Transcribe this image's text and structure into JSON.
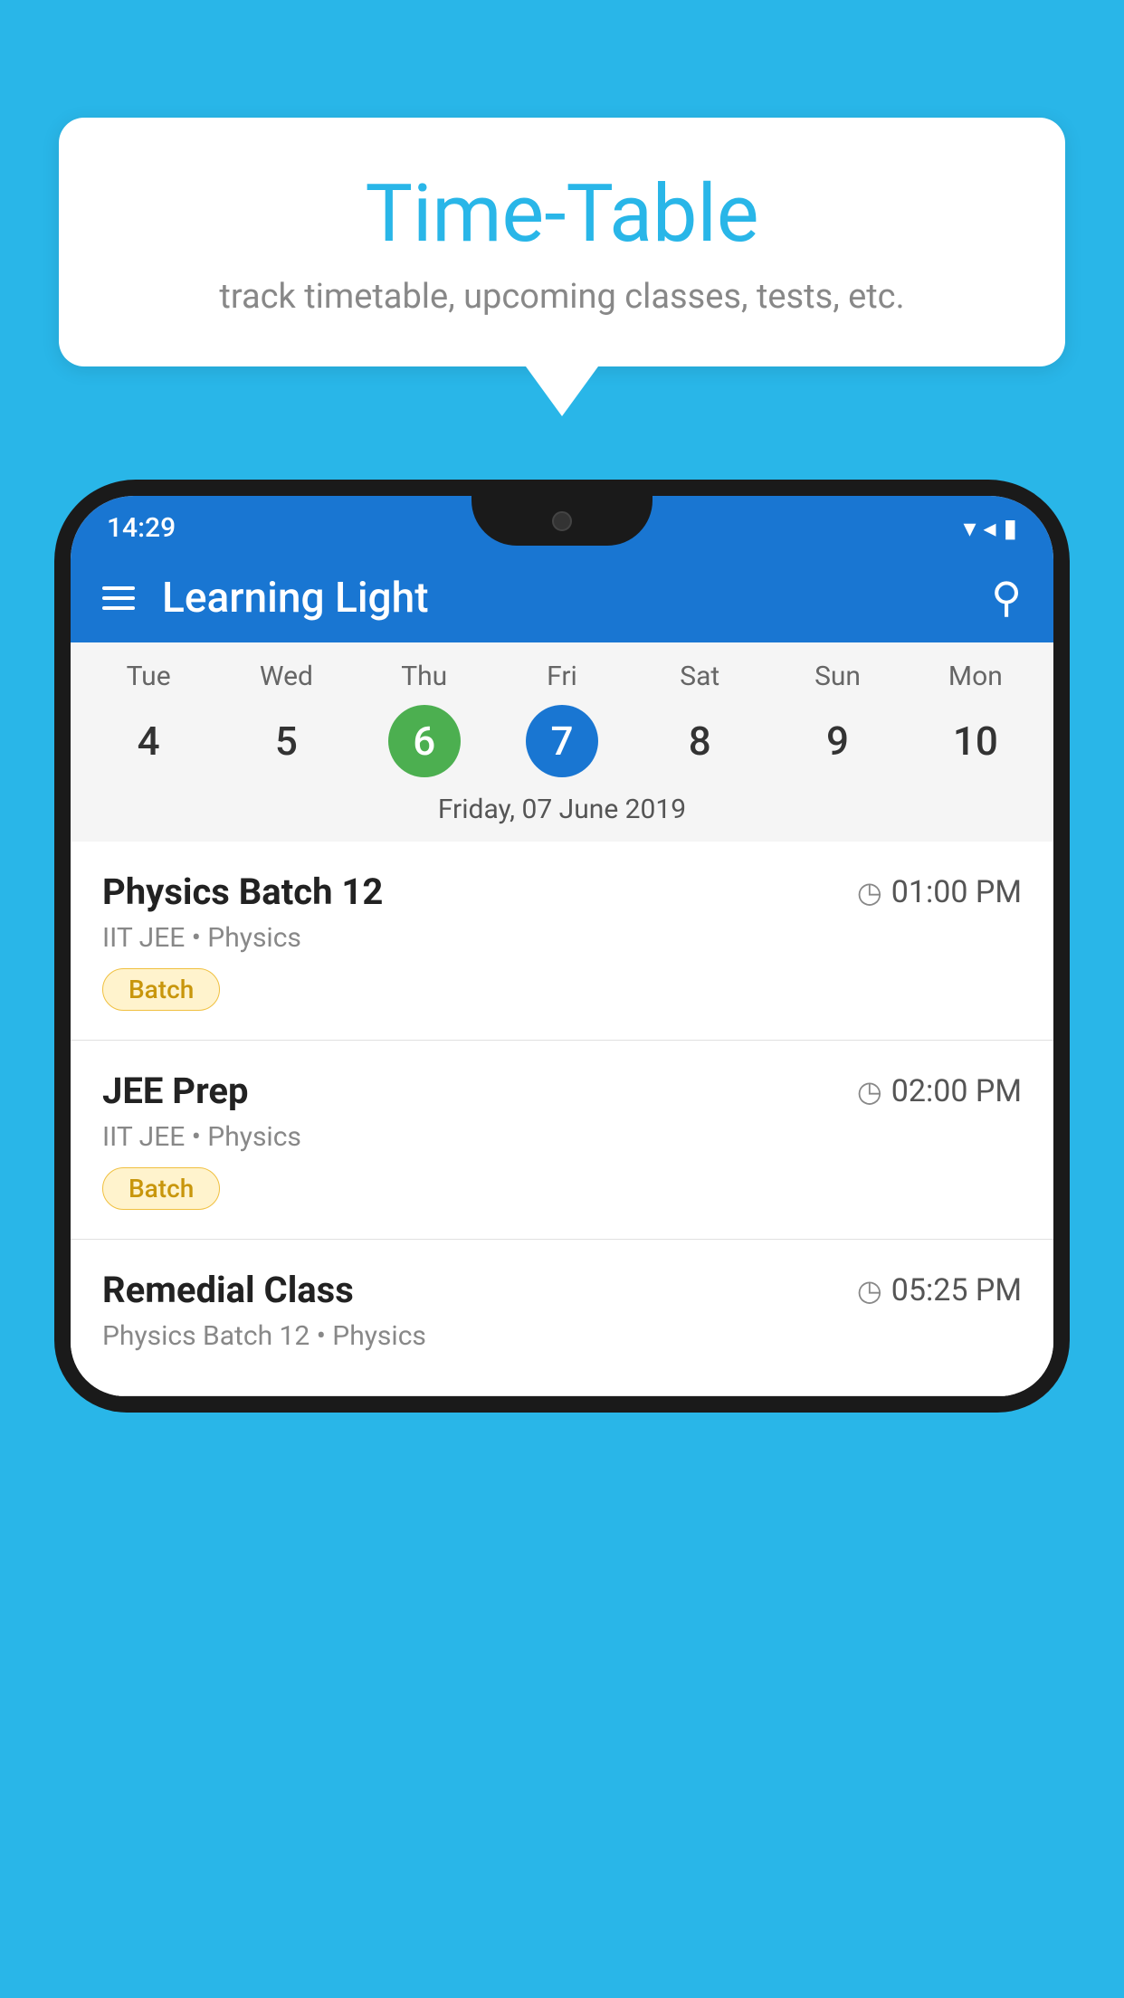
{
  "background_color": "#29B6E8",
  "speech_bubble": {
    "title": "Time-Table",
    "subtitle": "track timetable, upcoming classes, tests, etc."
  },
  "phone": {
    "status_bar": {
      "time": "14:29",
      "icons": "▼◀▌"
    },
    "app_bar": {
      "title": "Learning Light"
    },
    "calendar": {
      "days": [
        {
          "name": "Tue",
          "num": "4",
          "state": "normal"
        },
        {
          "name": "Wed",
          "num": "5",
          "state": "normal"
        },
        {
          "name": "Thu",
          "num": "6",
          "state": "today"
        },
        {
          "name": "Fri",
          "num": "7",
          "state": "selected"
        },
        {
          "name": "Sat",
          "num": "8",
          "state": "normal"
        },
        {
          "name": "Sun",
          "num": "9",
          "state": "normal"
        },
        {
          "name": "Mon",
          "num": "10",
          "state": "normal"
        }
      ],
      "selected_date_label": "Friday, 07 June 2019"
    },
    "schedule": [
      {
        "title": "Physics Batch 12",
        "time": "01:00 PM",
        "subtitle": "IIT JEE • Physics",
        "tag": "Batch"
      },
      {
        "title": "JEE Prep",
        "time": "02:00 PM",
        "subtitle": "IIT JEE • Physics",
        "tag": "Batch"
      },
      {
        "title": "Remedial Class",
        "time": "05:25 PM",
        "subtitle": "Physics Batch 12 • Physics",
        "tag": null
      }
    ]
  }
}
